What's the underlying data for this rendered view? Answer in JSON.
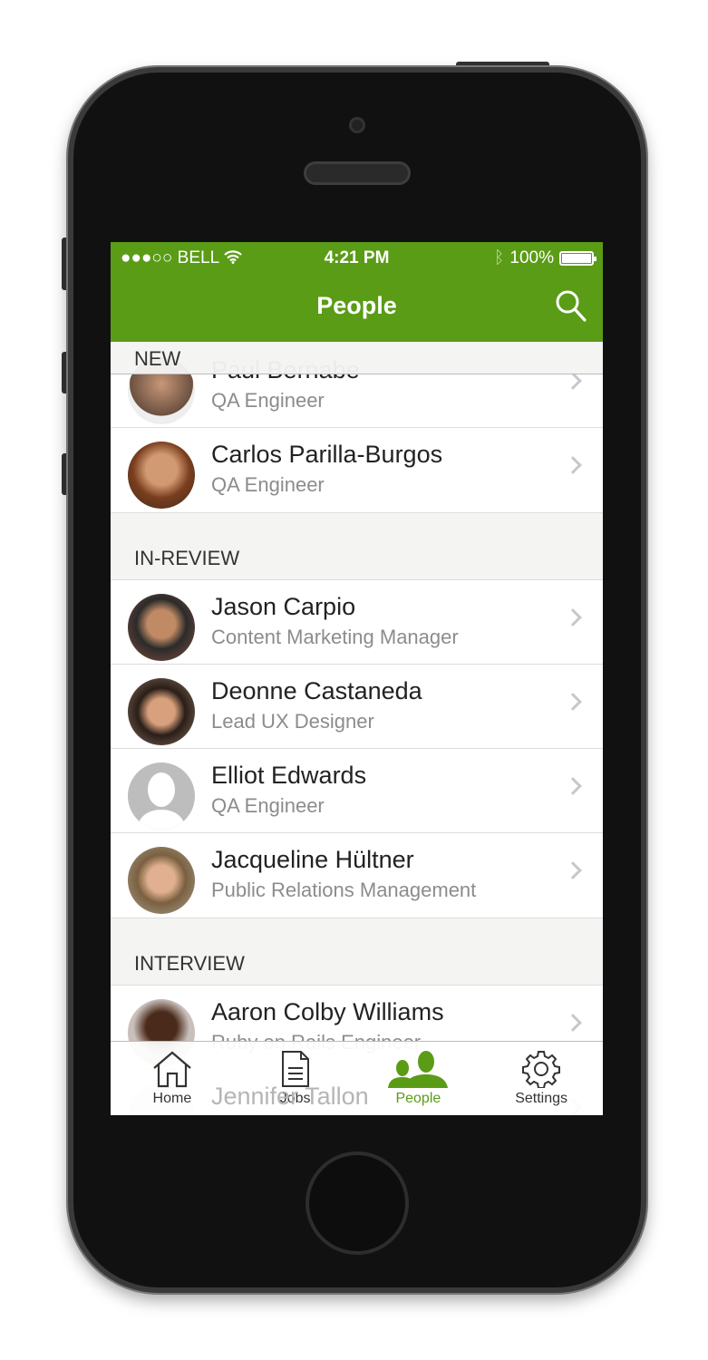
{
  "status_bar": {
    "carrier": "●●●○○ BELL",
    "time": "4:21 PM",
    "battery": "100%"
  },
  "nav": {
    "title": "People",
    "search_icon": "search-icon"
  },
  "accent_color": "#5a9c16",
  "sections": [
    {
      "label": "NEW",
      "people": [
        {
          "name": "Paul Bernabe",
          "role": "QA Engineer"
        },
        {
          "name": "Carlos Parilla-Burgos",
          "role": "QA Engineer"
        }
      ]
    },
    {
      "label": "IN-REVIEW",
      "people": [
        {
          "name": "Jason Carpio",
          "role": "Content Marketing Manager"
        },
        {
          "name": "Deonne Castaneda",
          "role": "Lead UX Designer"
        },
        {
          "name": "Elliot Edwards",
          "role": "QA Engineer"
        },
        {
          "name": "Jacqueline Hültner",
          "role": "Public Relations Management"
        }
      ]
    },
    {
      "label": "INTERVIEW",
      "people": [
        {
          "name": "Aaron Colby Williams",
          "role": "Ruby on Rails Engineer"
        },
        {
          "name": "Jennifer Tallon",
          "role": ""
        }
      ]
    }
  ],
  "tabs": [
    {
      "label": "Home",
      "icon": "home-icon"
    },
    {
      "label": "Jobs",
      "icon": "document-icon"
    },
    {
      "label": "People",
      "icon": "people-icon",
      "active": true
    },
    {
      "label": "Settings",
      "icon": "gear-icon"
    }
  ]
}
